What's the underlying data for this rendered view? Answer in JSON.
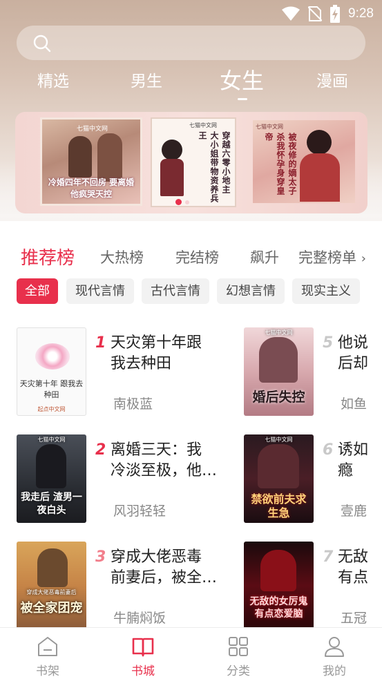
{
  "status_bar": {
    "time": "9:28"
  },
  "search": {
    "placeholder": ""
  },
  "top_tabs": [
    {
      "label": "精选"
    },
    {
      "label": "男生"
    },
    {
      "label": "女生",
      "active": true
    },
    {
      "label": "漫画"
    }
  ],
  "banner": {
    "covers": [
      {
        "publisher": "七猫中文网",
        "title": "冷婚四年不回房 要离婚他疯哭天控"
      },
      {
        "publisher": "七猫中文网",
        "title": "穿越六零小地主 大小姐带物资养兵王"
      },
      {
        "publisher": "七猫中文网",
        "title": "被夜修的嫡太子 杀我怀孕身穿皇帝"
      }
    ]
  },
  "rank_tabs": [
    {
      "label": "推荐榜",
      "active": true
    },
    {
      "label": "大热榜"
    },
    {
      "label": "完结榜"
    },
    {
      "label": "飙升"
    }
  ],
  "rank_more": "完整榜单",
  "chips": [
    {
      "label": "全部",
      "active": true
    },
    {
      "label": "现代言情"
    },
    {
      "label": "古代言情"
    },
    {
      "label": "幻想言情"
    },
    {
      "label": "现实主义"
    }
  ],
  "books": [
    {
      "rank": "1",
      "title": "天灾第十年跟我去种田",
      "title_l1": "天灾第十年跟",
      "title_l2": "我去种田",
      "author": "南极蓝",
      "cover_text": "天灾第十年 跟我去种田",
      "cover_publisher": "起点中文网"
    },
    {
      "rank": "2",
      "title_l1": "离婚三天：我",
      "title_l2": "冷淡至极，他…",
      "author": "风羽轻轻",
      "cover_text": "我走后 渣男一夜白头",
      "cover_publisher": "七猫中文网"
    },
    {
      "rank": "3",
      "title_l1": "穿成大佬恶毒",
      "title_l2": "前妻后，被全…",
      "author": "牛腩焖饭",
      "cover_text": "被全家团宠",
      "cover_publisher": "穿成大佬恶毒前妻后"
    },
    {
      "rank": "5",
      "title_l1": "他说",
      "title_l2": "后却",
      "author": "如鱼",
      "cover_text": "婚后失控",
      "cover_publisher": "七猫中文网"
    },
    {
      "rank": "6",
      "title_l1": "诱如",
      "title_l2": "瘾",
      "author": "壹鹿",
      "cover_text": "禁欲前夫求生急",
      "cover_publisher": "七猫中文网"
    },
    {
      "rank": "7",
      "title_l1": "无敌",
      "title_l2": "有点",
      "author": "五冠",
      "cover_text": "无敌的女厉鬼有点恋爱脑",
      "cover_publisher": ""
    }
  ],
  "bottom_nav": [
    {
      "label": "书架",
      "icon": "bookshelf-icon"
    },
    {
      "label": "书城",
      "icon": "open-book-icon",
      "active": true
    },
    {
      "label": "分类",
      "icon": "grid-icon"
    },
    {
      "label": "我的",
      "icon": "user-icon"
    }
  ],
  "colors": {
    "accent": "#e8304c",
    "rank_top": "#e8304c",
    "rank_other": "#c9c9c9"
  }
}
